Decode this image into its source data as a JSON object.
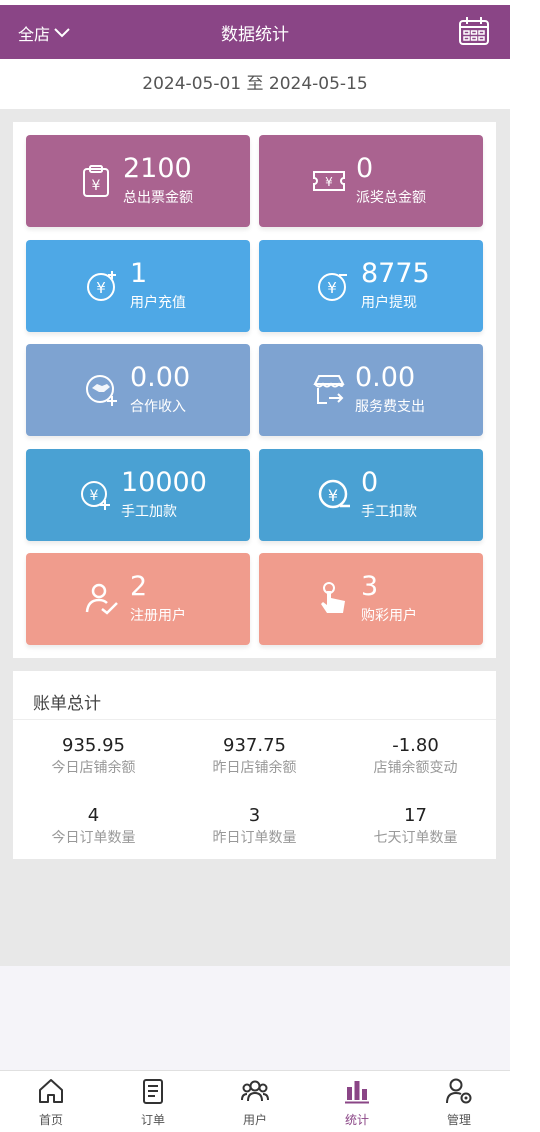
{
  "header": {
    "store_label": "全店",
    "title": "数据统计",
    "calendar_icon": "calendar-icon"
  },
  "date_range": "2024-05-01 至 2024-05-15",
  "stats": [
    {
      "value": "2100",
      "label": "总出票金额",
      "icon": "ticket-clipboard-icon",
      "color": "#aa6390"
    },
    {
      "value": "0",
      "label": "派奖总金额",
      "icon": "prize-ticket-icon",
      "color": "#aa6390"
    },
    {
      "value": "1",
      "label": "用户充值",
      "icon": "recharge-icon",
      "color": "#4ea8e6"
    },
    {
      "value": "8775",
      "label": "用户提现",
      "icon": "withdraw-icon",
      "color": "#4ea8e6"
    },
    {
      "value": "0.00",
      "label": "合作收入",
      "icon": "handshake-income-icon",
      "color": "#7ea3d1"
    },
    {
      "value": "0.00",
      "label": "服务费支出",
      "icon": "store-expense-icon",
      "color": "#7ea3d1"
    },
    {
      "value": "10000",
      "label": "手工加款",
      "icon": "manual-add-icon",
      "color": "#4aa1d3"
    },
    {
      "value": "0",
      "label": "手工扣款",
      "icon": "manual-deduct-icon",
      "color": "#4aa1d3"
    },
    {
      "value": "2",
      "label": "注册用户",
      "icon": "user-check-icon",
      "color": "#f09c8d"
    },
    {
      "value": "3",
      "label": "购彩用户",
      "icon": "tap-hand-icon",
      "color": "#f09c8d"
    }
  ],
  "bill": {
    "title": "账单总计",
    "items": [
      {
        "value": "935.95",
        "label": "今日店铺余额"
      },
      {
        "value": "937.75",
        "label": "昨日店铺余额"
      },
      {
        "value": "-1.80",
        "label": "店铺余额变动"
      },
      {
        "value": "4",
        "label": "今日订单数量"
      },
      {
        "value": "3",
        "label": "昨日订单数量"
      },
      {
        "value": "17",
        "label": "七天订单数量"
      }
    ]
  },
  "tabbar": [
    {
      "label": "首页",
      "icon": "home-icon"
    },
    {
      "label": "订单",
      "icon": "order-icon"
    },
    {
      "label": "用户",
      "icon": "users-icon"
    },
    {
      "label": "统计",
      "icon": "chart-icon",
      "active": true
    },
    {
      "label": "管理",
      "icon": "manage-user-gear-icon"
    }
  ]
}
